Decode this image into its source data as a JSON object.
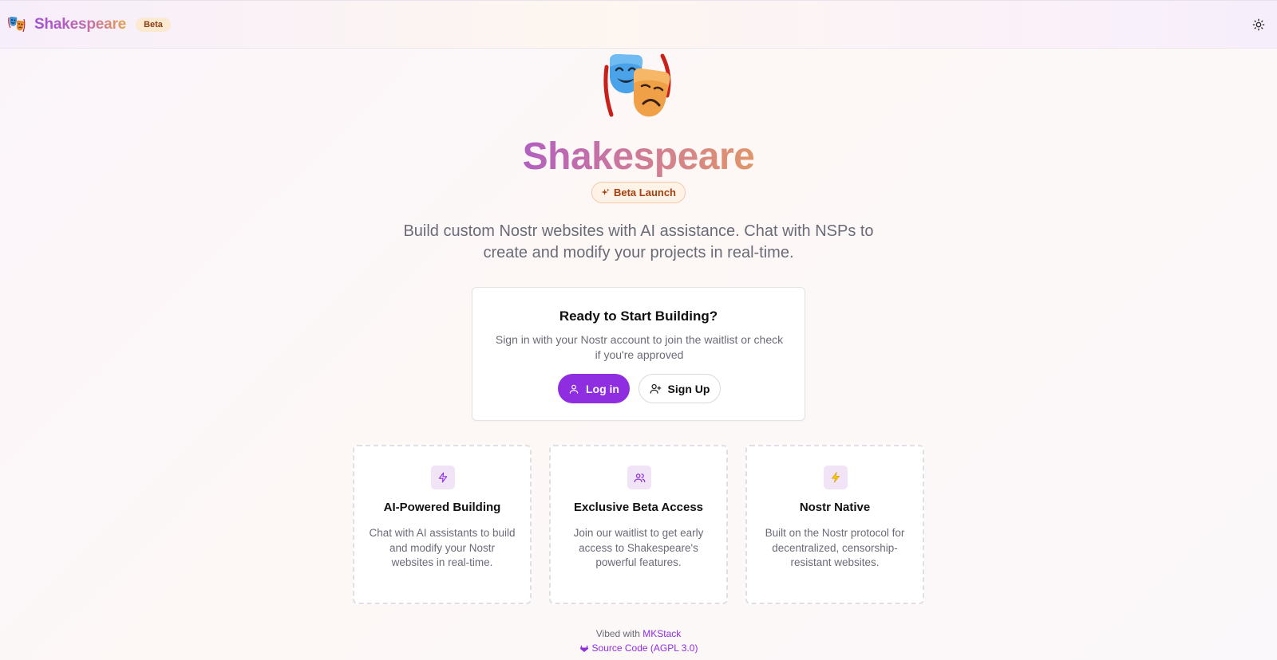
{
  "header": {
    "brand_name": "Shakespeare",
    "beta_label": "Beta",
    "theme_icon": "sun-icon"
  },
  "hero": {
    "icon": "theater-masks-icon",
    "title": "Shakespeare",
    "badge": "Beta Launch",
    "tagline": "Build custom Nostr websites with AI assistance. Chat with NSPs to create and modify your projects in real-time."
  },
  "auth_card": {
    "title": "Ready to Start Building?",
    "subtitle": "Sign in with your Nostr account to join the waitlist or check if you're approved",
    "login_label": "Log in",
    "signup_label": "Sign Up"
  },
  "features": [
    {
      "icon": "zap-outline-icon",
      "title": "AI-Powered Building",
      "description": "Chat with AI assistants to build and modify your Nostr websites in real-time."
    },
    {
      "icon": "users-icon",
      "title": "Exclusive Beta Access",
      "description": "Join our waitlist to get early access to Shakespeare's powerful features."
    },
    {
      "icon": "lightning-emoji-icon",
      "title": "Nostr Native",
      "description": "Built on the Nostr protocol for decentralized, censorship-resistant websites."
    }
  ],
  "footer": {
    "vibed_prefix": "Vibed with",
    "mkstack_link": "MKStack",
    "source_link": "Source Code (AGPL 3.0)"
  },
  "colors": {
    "primary": "#8e2ee0",
    "badge_text": "#a4400f",
    "badge_bg": "#fff3e7",
    "muted_text": "#6b6b78"
  }
}
